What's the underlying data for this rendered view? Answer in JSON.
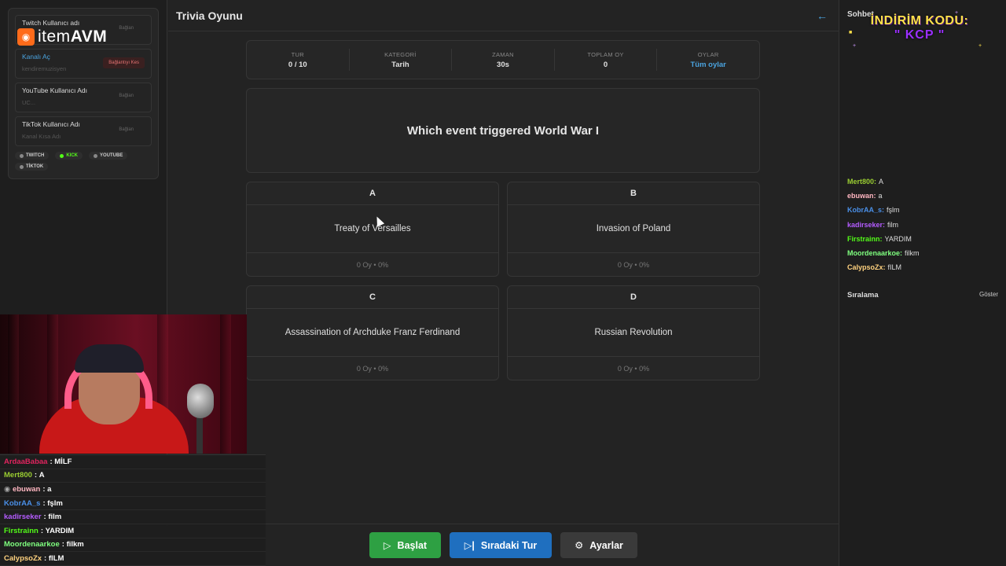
{
  "app": {
    "title": "Trivia Oyunu"
  },
  "accounts": [
    {
      "label": "Twitch Kullanıcı adı",
      "sub": "",
      "action": "Bağlan",
      "active": false
    },
    {
      "label": "Kanalı Aç",
      "sub": "kendiremuzisyen",
      "action": "Bağlantıyı Kes",
      "active": true
    },
    {
      "label": "YouTube Kullanıcı Adı",
      "sub": "UC...",
      "action": "Bağlan",
      "active": false
    },
    {
      "label": "TikTok Kullanıcı Adı",
      "sub": "Kanal Kısa Adı",
      "action": "Bağlan",
      "active": false
    }
  ],
  "platforms": [
    {
      "name": "TWITCH",
      "live": false
    },
    {
      "name": "KICK",
      "live": true
    },
    {
      "name": "YOUTUBE",
      "live": false
    },
    {
      "name": "TİKTOK",
      "live": false
    }
  ],
  "logo": {
    "brand": "item",
    "brand2": "AVM",
    "accent": "#ff6b1a"
  },
  "stats": [
    {
      "key": "TUR",
      "value": "0 / 10"
    },
    {
      "key": "KATEGORİ",
      "value": "Tarih"
    },
    {
      "key": "ZAMAN",
      "value": "30s"
    },
    {
      "key": "TOPLAM OY",
      "value": "0"
    },
    {
      "key": "OYLAR",
      "value": "Tüm oylar"
    }
  ],
  "question": "Which event triggered World War I",
  "answers": [
    {
      "letter": "A",
      "text": "Treaty of Versailles",
      "votes": "0 Oy • 0%"
    },
    {
      "letter": "B",
      "text": "Invasion of Poland",
      "votes": "0 Oy • 0%"
    },
    {
      "letter": "C",
      "text": "Assassination of Archduke Franz Ferdinand",
      "votes": "0 Oy • 0%"
    },
    {
      "letter": "D",
      "text": "Russian Revolution",
      "votes": "0 Oy • 0%"
    }
  ],
  "buttons": {
    "start": "Başlat",
    "next": "Sıradaki Tur",
    "settings": "Ayarlar"
  },
  "overlay_chat": [
    {
      "user": "ArdaaBabaa",
      "msg": "MİLF",
      "color": "#e0245e"
    },
    {
      "user": "Mert800",
      "msg": "A",
      "color": "#9acd32"
    },
    {
      "user": "ebuwan",
      "msg": "a",
      "color": "#ffb6c1"
    },
    {
      "user": "KobrAA_s",
      "msg": "fşlm",
      "color": "#4a8fe7"
    },
    {
      "user": "kadirseker",
      "msg": "film",
      "color": "#b45cff"
    },
    {
      "user": "Firstrainn",
      "msg": "YARDIM",
      "color": "#53fc18"
    },
    {
      "user": "Moordenaarkoe",
      "msg": "filkm",
      "color": "#7fff7f"
    },
    {
      "user": "CalypsoZx",
      "msg": "fILM",
      "color": "#ffd27f"
    }
  ],
  "side_chat": {
    "title": "Sohbet",
    "messages": [
      {
        "user": "Mert800:",
        "msg": "A",
        "color": "#9acd32"
      },
      {
        "user": "ebuwan:",
        "msg": "a",
        "color": "#ffb6c1"
      },
      {
        "user": "KobrAA_s:",
        "msg": "fşlm",
        "color": "#4a8fe7"
      },
      {
        "user": "kadirseker:",
        "msg": "film",
        "color": "#b45cff"
      },
      {
        "user": "Firstrainn:",
        "msg": "YARDIM",
        "color": "#53fc18"
      },
      {
        "user": "Moordenaarkoe:",
        "msg": "filkm",
        "color": "#7fff7f"
      },
      {
        "user": "CalypsoZx:",
        "msg": "fILM",
        "color": "#ffd27f"
      }
    ]
  },
  "promo": {
    "line1": "İNDİRİM KODU:",
    "line2": "\" KCP \""
  },
  "ranking": {
    "title": "Sıralama",
    "show": "Göster"
  }
}
